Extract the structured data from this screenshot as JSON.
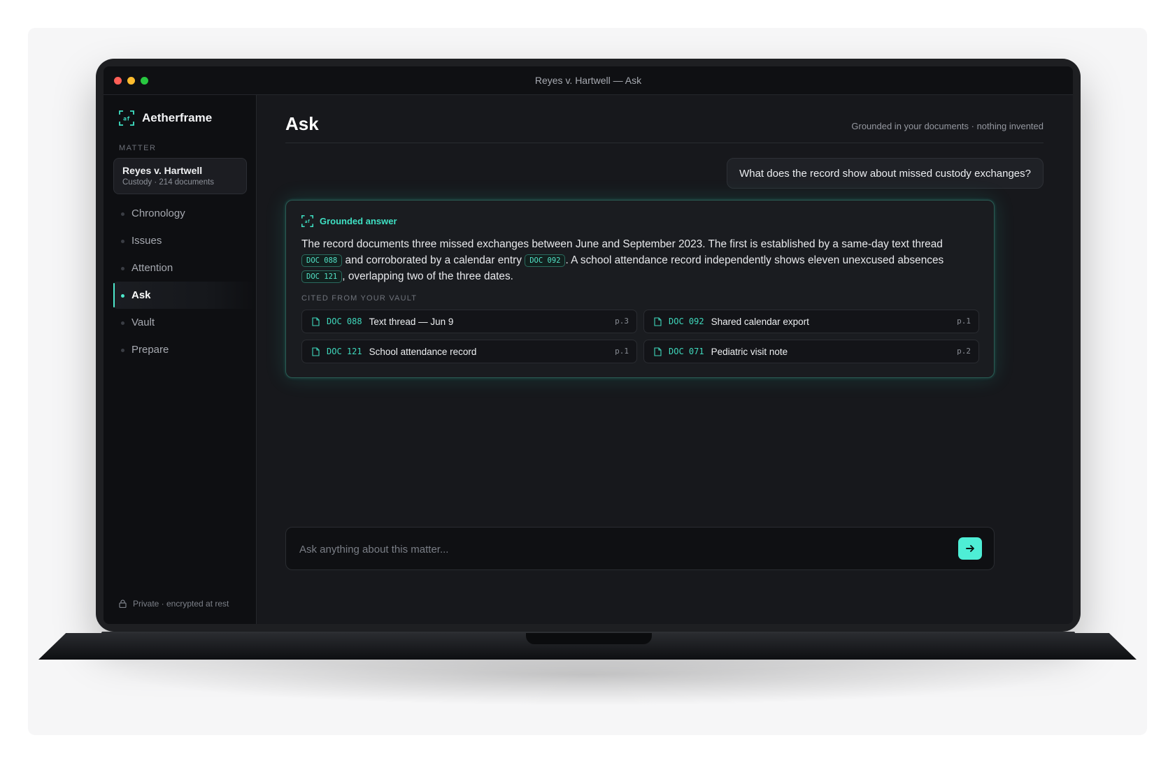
{
  "window": {
    "title": "Reyes v. Hartwell — Ask"
  },
  "sidebar": {
    "brand": "Aetherframe",
    "section_label": "MATTER",
    "matter": {
      "name": "Reyes v. Hartwell",
      "meta": "Custody · 214 documents"
    },
    "items": [
      {
        "label": "Chronology",
        "active": false
      },
      {
        "label": "Issues",
        "active": false
      },
      {
        "label": "Attention",
        "active": false
      },
      {
        "label": "Ask",
        "active": true
      },
      {
        "label": "Vault",
        "active": false
      },
      {
        "label": "Prepare",
        "active": false
      }
    ],
    "footer": "Private · encrypted at rest"
  },
  "main": {
    "title": "Ask",
    "tagline": "Grounded in your documents · nothing invented",
    "question": "What does the record show about missed custody exchanges?",
    "answer": {
      "label": "Grounded answer",
      "p1": "The record documents three missed exchanges between June and September 2023. The first is established by a same-day text thread ",
      "c1": "DOC 088",
      "p2": " and corroborated by a calendar entry ",
      "c2": "DOC 092",
      "p3": ". A school attendance record independently shows eleven unexcused absences ",
      "c3": "DOC 121",
      "p4": ", overlapping two of the three dates."
    },
    "cited_label": "CITED FROM YOUR VAULT",
    "sources": [
      {
        "id": "DOC 088",
        "title": "Text thread — Jun 9",
        "page": "p.3"
      },
      {
        "id": "DOC 092",
        "title": "Shared calendar export",
        "page": "p.1"
      },
      {
        "id": "DOC 121",
        "title": "School attendance record",
        "page": "p.1"
      },
      {
        "id": "DOC 071",
        "title": "Pediatric visit note",
        "page": "p.2"
      }
    ],
    "input": {
      "placeholder": "Ask anything about this matter...",
      "value": ""
    }
  },
  "colors": {
    "accent": "#4de8cc",
    "background": "#17181c",
    "sidebar": "#0e0f12"
  }
}
